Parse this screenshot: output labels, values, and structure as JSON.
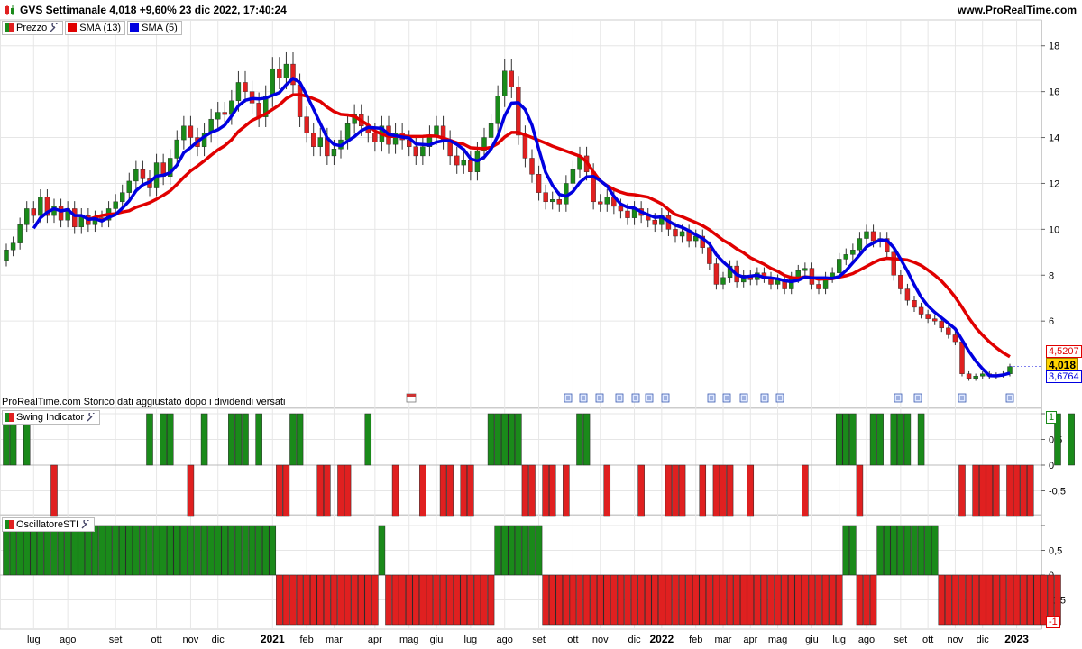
{
  "header": {
    "title": "GVS Settimanale 4,018 +9,60% 23 dic 2022, 17:40:24",
    "site": "www.ProRealTime.com"
  },
  "legend": {
    "prezzo": "Prezzo",
    "sma13": "SMA (13)",
    "sma5": "SMA (5)"
  },
  "notes": {
    "storico": "ProRealTime.com Storico dati aggiustato dopo i dividendi versati"
  },
  "panes": {
    "swing_label": "Swing Indicator",
    "osc_label": "OscillatoreSTI"
  },
  "tags": {
    "sma13": "4,5207",
    "price": "4,018",
    "sma5": "3,6764",
    "swing_top": "1",
    "osc_bottom": "-1"
  },
  "colors": {
    "up": "#1a8a1a",
    "down": "#e02020",
    "sma13": "#e00000",
    "sma5": "#0000e0",
    "grid": "#e6e6e6"
  },
  "chart_data": [
    {
      "type": "candlestick",
      "title": "GVS Settimanale",
      "ylim": [
        3.1,
        18.5
      ],
      "yticks": [
        6,
        8,
        10,
        12,
        14,
        16,
        18
      ],
      "ytick_labels": [
        "6",
        "8",
        "10",
        "12",
        "14",
        "16",
        "18"
      ],
      "x_labels": [
        "lug",
        "ago",
        "set",
        "ott",
        "nov",
        "dic",
        "2021",
        "feb",
        "mar",
        "apr",
        "mag",
        "giu",
        "lug",
        "ago",
        "set",
        "ott",
        "nov",
        "dic",
        "2022",
        "feb",
        "mar",
        "apr",
        "mag",
        "giu",
        "lug",
        "ago",
        "set",
        "ott",
        "nov",
        "dic",
        "2023"
      ],
      "x_label_weeks": [
        4,
        9,
        16,
        22,
        27,
        31,
        39,
        44,
        48,
        54,
        59,
        63,
        68,
        73,
        78,
        83,
        87,
        92,
        96,
        101,
        105,
        109,
        113,
        118,
        122,
        126,
        131,
        135,
        139,
        143,
        148
      ],
      "close": [
        9.1,
        9.4,
        10.2,
        10.9,
        10.6,
        11.4,
        10.6,
        11.0,
        10.4,
        10.9,
        10.1,
        10.6,
        10.2,
        10.5,
        10.4,
        10.9,
        11.2,
        11.6,
        12.1,
        12.6,
        12.2,
        11.8,
        12.9,
        12.3,
        13.1,
        13.9,
        14.5,
        14.0,
        13.6,
        14.2,
        14.8,
        15.1,
        15.0,
        15.6,
        16.4,
        16.0,
        15.5,
        14.9,
        15.8,
        17.0,
        16.6,
        17.2,
        16.3,
        14.9,
        14.2,
        13.6,
        14.0,
        13.2,
        13.5,
        13.9,
        14.6,
        15.0,
        14.5,
        14.2,
        13.8,
        14.5,
        13.7,
        14.2,
        13.9,
        13.6,
        13.2,
        13.6,
        14.1,
        14.5,
        13.9,
        13.2,
        12.8,
        13.0,
        12.5,
        13.4,
        14.0,
        14.6,
        15.8,
        16.9,
        16.2,
        14.1,
        13.1,
        12.4,
        11.6,
        11.2,
        11.3,
        11.1,
        12.0,
        12.6,
        13.2,
        12.5,
        11.2,
        11.1,
        11.4,
        11.0,
        10.8,
        10.5,
        10.9,
        10.6,
        10.4,
        10.2,
        10.6,
        10.0,
        9.7,
        9.9,
        9.5,
        9.7,
        9.2,
        8.5,
        7.6,
        7.9,
        8.4,
        7.7,
        8.0,
        7.8,
        8.1,
        7.9,
        7.6,
        7.8,
        7.4,
        7.9,
        8.2,
        8.3,
        7.6,
        7.4,
        7.9,
        8.1,
        8.7,
        8.9,
        9.1,
        9.6,
        9.9,
        9.5,
        9.6,
        9.0,
        8.0,
        7.4,
        6.9,
        6.6,
        6.3,
        6.1,
        6.0,
        5.7,
        5.4,
        5.1,
        3.7,
        3.5,
        3.6,
        3.7,
        3.6,
        3.65,
        3.7,
        4.018
      ],
      "sma13_value_last": 4.5207,
      "sma5_value_last": 3.6764,
      "last_price": 4.018
    },
    {
      "type": "bar",
      "title": "Swing Indicator",
      "ylim": [
        -1,
        1
      ],
      "yticks": [
        1,
        0.5,
        0,
        -0.5
      ],
      "ytick_labels": [
        "1",
        "0,5",
        "0",
        "-0,5"
      ],
      "values": [
        1,
        1,
        0,
        1,
        0,
        0,
        0,
        -1,
        0,
        0,
        0,
        0,
        0,
        0,
        0,
        0,
        0,
        0,
        0,
        0,
        0,
        1,
        0,
        1,
        1,
        0,
        0,
        -1,
        0,
        1,
        0,
        0,
        0,
        1,
        1,
        1,
        0,
        1,
        0,
        0,
        -1,
        -1,
        1,
        1,
        0,
        0,
        -1,
        -1,
        0,
        -1,
        -1,
        0,
        0,
        1,
        0,
        0,
        0,
        -1,
        0,
        0,
        0,
        -1,
        0,
        0,
        -1,
        -1,
        0,
        -1,
        -1,
        0,
        0,
        1,
        1,
        1,
        1,
        1,
        -1,
        -1,
        0,
        -1,
        -1,
        0,
        -1,
        0,
        1,
        1,
        0,
        0,
        -1,
        0,
        0,
        0,
        0,
        -1,
        0,
        0,
        0,
        -1,
        -1,
        -1,
        0,
        0,
        -1,
        0,
        -1,
        -1,
        -1,
        0,
        0,
        -1,
        0,
        0,
        0,
        0,
        0,
        0,
        0,
        -1,
        0,
        0,
        0,
        0,
        1,
        1,
        1,
        -1,
        0,
        1,
        1,
        0,
        1,
        1,
        1,
        0,
        1,
        0,
        0,
        0,
        0,
        0,
        -1,
        0,
        -1,
        -1,
        -1,
        -1,
        0,
        -1,
        -1,
        -1,
        -1,
        0,
        0,
        0,
        1,
        0,
        1
      ]
    },
    {
      "type": "bar",
      "title": "OscillatoreSTI",
      "ylim": [
        -1,
        1
      ],
      "yticks": [
        1,
        0.5,
        0,
        -0.5
      ],
      "ytick_labels": [
        "1",
        "0,5",
        "0",
        "-0,5"
      ],
      "values": [
        1,
        1,
        1,
        1,
        1,
        1,
        1,
        1,
        1,
        1,
        1,
        1,
        1,
        1,
        1,
        1,
        1,
        1,
        1,
        1,
        1,
        1,
        1,
        1,
        1,
        1,
        1,
        1,
        1,
        1,
        1,
        1,
        1,
        1,
        1,
        1,
        1,
        1,
        1,
        1,
        -1,
        -1,
        -1,
        -1,
        -1,
        -1,
        -1,
        -1,
        -1,
        -1,
        -1,
        -1,
        -1,
        -1,
        -1,
        1,
        -1,
        -1,
        -1,
        -1,
        -1,
        -1,
        -1,
        -1,
        -1,
        -1,
        -1,
        -1,
        -1,
        -1,
        -1,
        -1,
        1,
        1,
        1,
        1,
        1,
        1,
        1,
        -1,
        -1,
        -1,
        -1,
        -1,
        -1,
        -1,
        -1,
        -1,
        -1,
        -1,
        -1,
        -1,
        -1,
        -1,
        -1,
        -1,
        -1,
        -1,
        -1,
        -1,
        -1,
        -1,
        -1,
        -1,
        -1,
        -1,
        -1,
        -1,
        -1,
        -1,
        -1,
        -1,
        -1,
        -1,
        -1,
        -1,
        -1,
        -1,
        -1,
        -1,
        -1,
        -1,
        -1,
        1,
        1,
        -1,
        -1,
        -1,
        1,
        1,
        1,
        1,
        1,
        1,
        1,
        1,
        1,
        -1,
        -1,
        -1,
        -1,
        -1,
        -1,
        -1,
        -1,
        -1,
        -1,
        -1,
        -1,
        -1,
        -1,
        -1,
        -1,
        -1,
        -1
      ]
    }
  ]
}
